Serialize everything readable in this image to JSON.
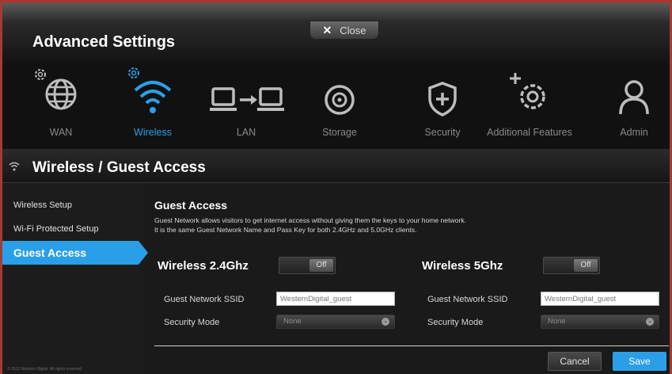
{
  "header": {
    "title": "Advanced Settings",
    "close_label": "Close"
  },
  "nav": {
    "items": [
      {
        "label": "WAN",
        "icon": "globe-icon"
      },
      {
        "label": "Wireless",
        "icon": "wifi-icon",
        "active": true
      },
      {
        "label": "LAN",
        "icon": "lan-icon"
      },
      {
        "label": "Storage",
        "icon": "storage-icon"
      },
      {
        "label": "Security",
        "icon": "shield-icon"
      },
      {
        "label": "Additional Features",
        "icon": "gear-plus-icon"
      },
      {
        "label": "Admin",
        "icon": "user-icon"
      }
    ]
  },
  "section": {
    "title": "Wireless / Guest Access"
  },
  "sidebar": {
    "items": [
      {
        "label": "Wireless Setup"
      },
      {
        "label": "Wi-Fi Protected Setup"
      },
      {
        "label": "Guest Access",
        "active": true
      }
    ]
  },
  "guest": {
    "title": "Guest Access",
    "desc_line1": "Guest Network allows visitors to get internet access without giving them the keys to your home network.",
    "desc_line2": "It is the same Guest Network Name and Pass Key for both 2.4GHz and 5.0GHz clients.",
    "band24": {
      "title": "Wireless 2.4Ghz",
      "toggle": "Off",
      "ssid_label": "Guest Network SSID",
      "ssid_placeholder": "WesternDigital_guest",
      "security_label": "Security Mode",
      "security_value": "None"
    },
    "band5": {
      "title": "Wireless 5Ghz",
      "toggle": "Off",
      "ssid_label": "Guest Network SSID",
      "ssid_placeholder": "WesternDigital_guest",
      "security_label": "Security Mode",
      "security_value": "None"
    }
  },
  "buttons": {
    "cancel": "Cancel",
    "save": "Save"
  },
  "footer": {
    "copyright": "© 2012 Western Digital. All rights reserved."
  },
  "colors": {
    "accent": "#2a9fe8",
    "frame_border": "#a33b33",
    "background": "#1a1a1a"
  }
}
